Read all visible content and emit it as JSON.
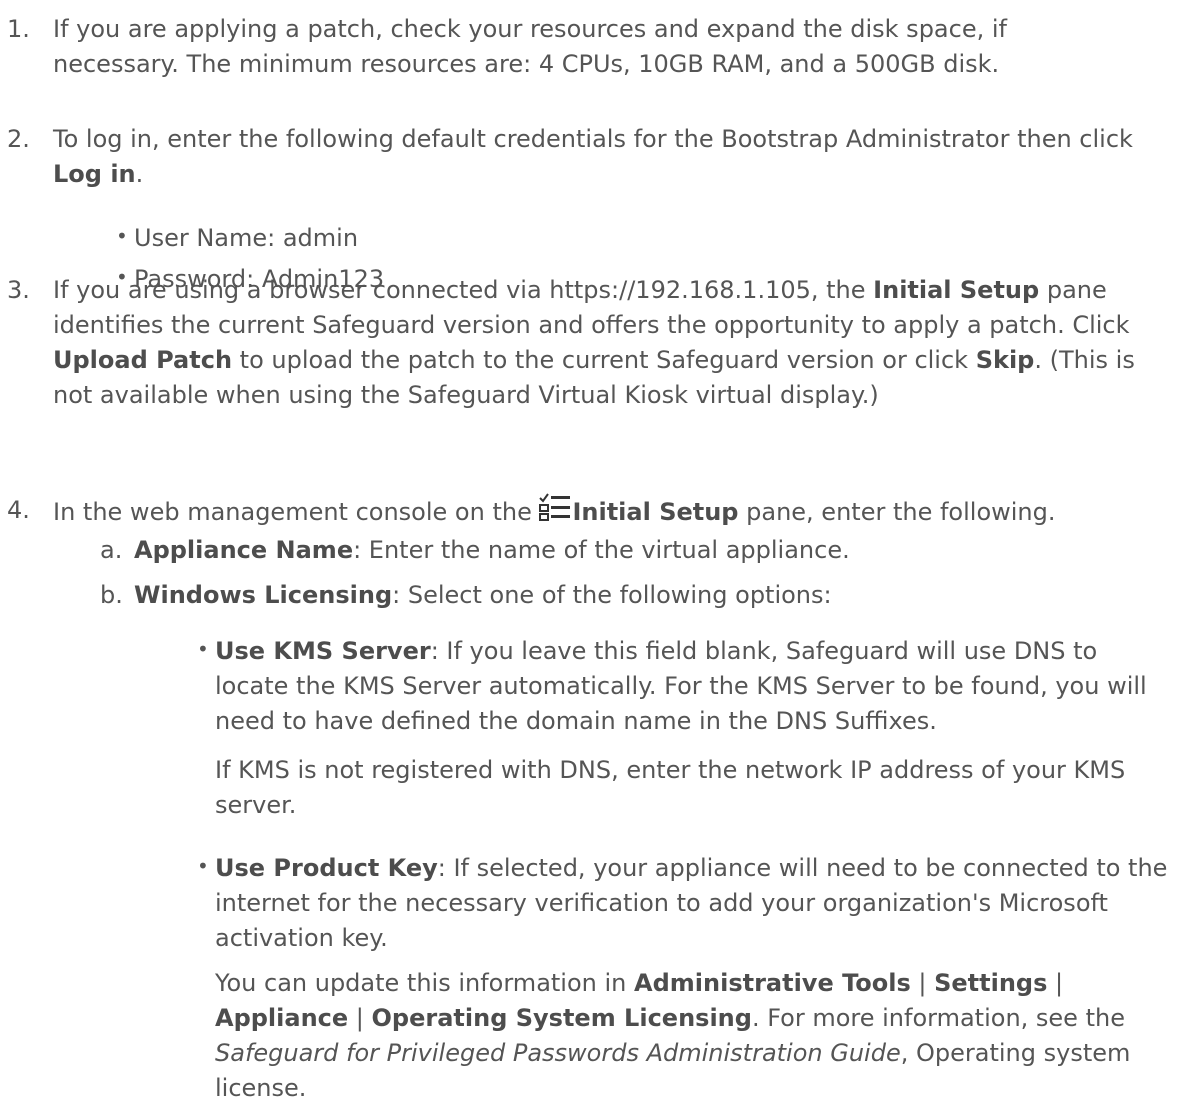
{
  "steps": {
    "s1": {
      "num": "1.",
      "text": "If you are applying a patch, check your resources and expand the disk space, if necessary. The minimum resources are: 4 CPUs, 10GB RAM, and a 500GB disk."
    },
    "s2": {
      "num": "2.",
      "pre": "To log in, enter the following default credentials for the Bootstrap Administrator then click ",
      "bold": "Log in",
      "post": ".",
      "bullets": [
        "User Name: admin",
        "Password: Admin123"
      ]
    },
    "s3": {
      "num": "3.",
      "t1": "If you are using a browser connected via https://192.168.1.105, the ",
      "b1": "Initial Setup",
      "t2": " pane identifies the current Safeguard version and offers the opportunity to apply a patch. Click ",
      "b2": "Upload Patch",
      "t3": " to upload the patch to the current Safeguard version or click ",
      "b3": "Skip",
      "t4": ". (This is not available when using the Safeguard Virtual Kiosk virtual display.)"
    },
    "s4": {
      "num": "4.",
      "pre": "In the web management console on the ",
      "icon": "checklist-icon",
      "bold": "Initial Setup",
      "post": " pane, enter the following.",
      "a": {
        "letter": "a.",
        "bold": "Appliance Name",
        "text": ": Enter the name of the virtual appliance."
      },
      "b": {
        "letter": "b.",
        "bold": "Windows Licensing",
        "text": ": Select one of the following options:",
        "kms": {
          "bold": "Use KMS Server",
          "text": ": If you leave this field blank, Safeguard will use DNS to locate the KMS Server automatically. For the KMS Server to be found, you will need to have defined the domain name in the DNS Suffixes.",
          "followup": "If KMS is not registered with DNS, enter the network IP address of your KMS server."
        },
        "pk": {
          "bold": "Use Product Key",
          "text": ": If selected, your appliance will need to be connected to the internet for the necessary verification to add your organization's Microsoft activation key.",
          "f_pre": "You can update this information in ",
          "f_b1": "Administrative Tools",
          "f_sep1": " | ",
          "f_b2": "Settings",
          "f_sep2": " | ",
          "f_b3": "Appliance",
          "f_sep3": " | ",
          "f_b4": "Operating System Licensing",
          "f_mid": ". For more information, see the ",
          "f_i1": "Safeguard for Privileged Passwords Administration Guide",
          "f_end": ", Operating system license."
        }
      }
    }
  }
}
